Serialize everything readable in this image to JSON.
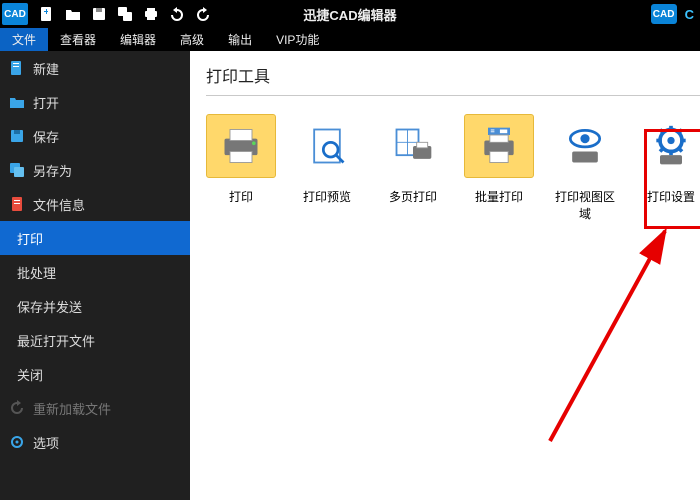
{
  "app": {
    "logo": "CAD",
    "title": "迅捷CAD编辑器",
    "cad_label": "CAD",
    "c_label": "C"
  },
  "menubar": {
    "items": [
      "文件",
      "查看器",
      "编辑器",
      "高级",
      "输出",
      "VIP功能"
    ]
  },
  "sidebar": {
    "items": [
      {
        "label": "新建"
      },
      {
        "label": "打开"
      },
      {
        "label": "保存"
      },
      {
        "label": "另存为"
      },
      {
        "label": "文件信息"
      },
      {
        "label": "打印"
      },
      {
        "label": "批处理"
      },
      {
        "label": "保存并发送"
      },
      {
        "label": "最近打开文件"
      },
      {
        "label": "关闭"
      },
      {
        "label": "重新加载文件"
      },
      {
        "label": "选项"
      }
    ]
  },
  "content": {
    "heading": "打印工具",
    "tools": [
      {
        "label": "打印"
      },
      {
        "label": "打印预览"
      },
      {
        "label": "多页打印"
      },
      {
        "label": "批量打印"
      },
      {
        "label": "打印视图区域"
      },
      {
        "label": "打印设置"
      }
    ]
  }
}
